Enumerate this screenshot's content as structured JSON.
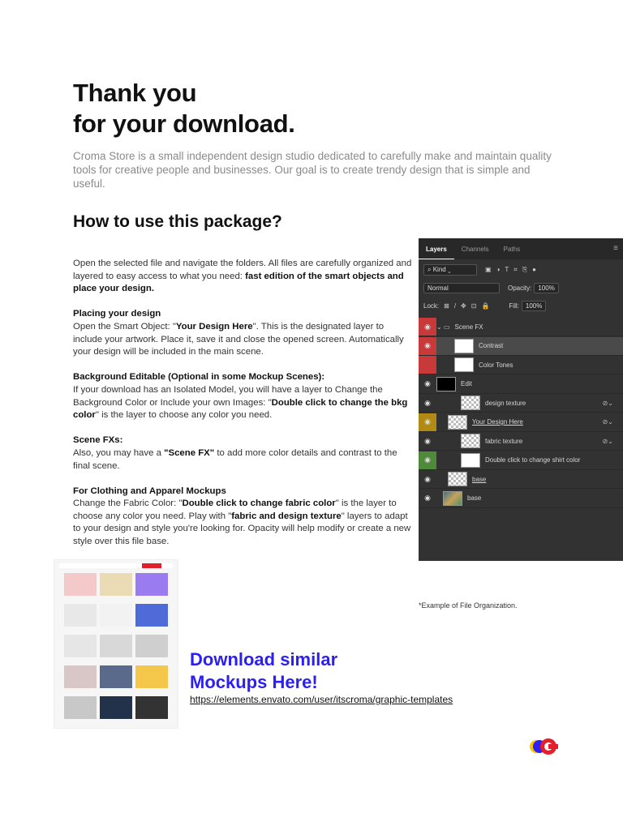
{
  "title": [
    "Thank you",
    "for your download."
  ],
  "intro": "Croma Store is a small independent design studio dedicated to carefully make and maintain quality tools for creative people and businesses.  Our goal is to create trendy design that is simple and useful.",
  "how_title": "How to use this package?",
  "p1_text": "Open the selected file and navigate the folders. All files are carefully organized and layered to easy access to what you need: ",
  "p1_bold": "fast edition of the smart objects and place your design.",
  "p2_title": "Placing your design",
  "p2_a": "Open the Smart Object: \"",
  "p2_b": "Your Design Here",
  "p2_c": "\". This is the designated layer to include your artwork. Place it, save it and close the opened screen. Automatically your design will be included in the main scene.",
  "p3_title": "Background Editable (Optional in some Mockup Scenes):",
  "p3_a": "If your download has an Isolated Model, you will have a layer to Change the Background Color or Include your own Images: \"",
  "p3_b": "Double click to change the bkg color",
  "p3_c": "\" is the layer to choose any color you need.",
  "p4_title": "Scene FXs:",
  "p4_a": "Also, you may have a ",
  "p4_b": "\"Scene FX\"",
  "p4_c": " to add more color details and contrast to the final scene.",
  "p5_title": "For Clothing and Apparel Mockups",
  "p5_a": "Change the Fabric Color: \"",
  "p5_b": "Double click to change fabric color",
  "p5_c": "\" is the layer to choose any color you need. Play with \"",
  "p5_d": "fabric and design texture",
  "p5_e": "\" layers to adapt to your design and style you're looking for. Opacity will help modify or create a new style over this file base.",
  "panel": {
    "tabs": [
      "Layers",
      "Channels",
      "Paths"
    ],
    "kind": "Kind",
    "blend": "Normal",
    "opacity_label": "Opacity:",
    "opacity": "100%",
    "lock_label": "Lock:",
    "fill_label": "Fill:",
    "fill": "100%",
    "layers": [
      {
        "name": "Scene FX",
        "eye_color": "#c83a3a"
      },
      {
        "name": "Contrast",
        "eye_color": "#c83a3a"
      },
      {
        "name": "Color Tones",
        "eye_color": "#c83a3a"
      },
      {
        "name": "Edit",
        "eye_color": "#323232"
      },
      {
        "name": "design texture",
        "eye_color": "#323232"
      },
      {
        "name": "Your Design Here",
        "eye_color": "#b08a12"
      },
      {
        "name": "fabric texture",
        "eye_color": "#323232"
      },
      {
        "name": "Double click to change shirt color",
        "eye_color": "#4f8a3a"
      },
      {
        "name": "base",
        "eye_color": "#323232"
      },
      {
        "name": "base",
        "eye_color": "#323232"
      }
    ]
  },
  "example_note": "*Example of File Organization.",
  "download": [
    "Download similar",
    "Mockups Here!"
  ],
  "link": "https://elements.envato.com/user/itscroma/graphic-templates",
  "colors": {
    "accent_blue": "#2b1ff5",
    "logo_red": "#e2202c",
    "logo_blue": "#2b1ff5",
    "logo_yellow": "#f5c400"
  }
}
